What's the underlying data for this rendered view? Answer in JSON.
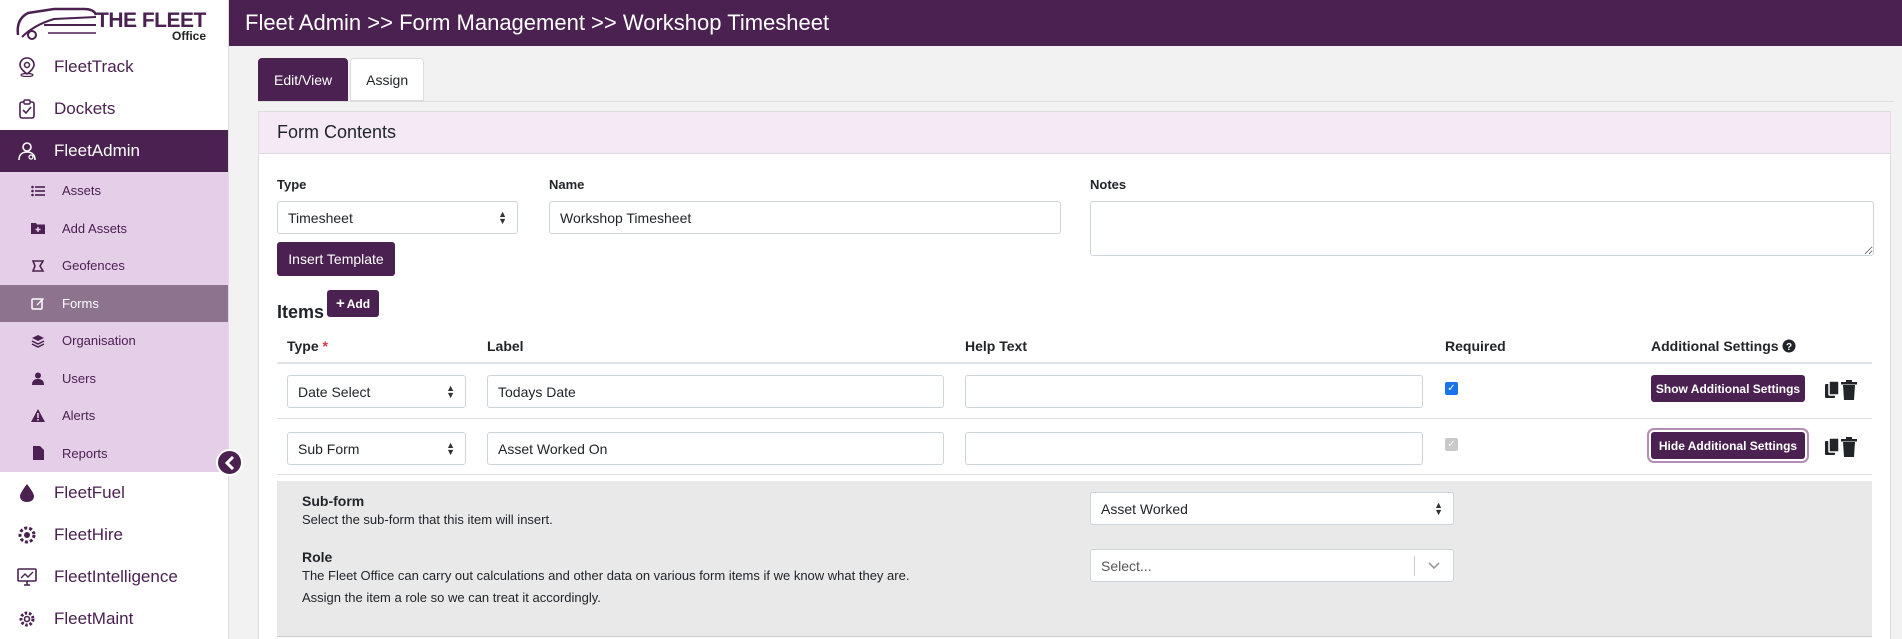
{
  "app": {
    "logo_text": "THE FLEET",
    "logo_sub": "Office",
    "breadcrumb": "Fleet Admin >> Form Management >> Workshop Timesheet"
  },
  "sidebar": {
    "main_top": [
      {
        "label": "FleetTrack",
        "icon": "map-pin-icon"
      },
      {
        "label": "Dockets",
        "icon": "clipboard-icon"
      },
      {
        "label": "FleetAdmin",
        "icon": "admin-user-icon",
        "active": true
      }
    ],
    "sub": [
      {
        "label": "Assets",
        "icon": "list-icon"
      },
      {
        "label": "Add Assets",
        "icon": "folder-plus-icon"
      },
      {
        "label": "Geofences",
        "icon": "geofence-icon"
      },
      {
        "label": "Forms",
        "icon": "edit-icon",
        "active": true
      },
      {
        "label": "Organisation",
        "icon": "layers-icon"
      },
      {
        "label": "Users",
        "icon": "user-icon"
      },
      {
        "label": "Alerts",
        "icon": "warning-icon"
      },
      {
        "label": "Reports",
        "icon": "report-icon"
      }
    ],
    "main_bottom": [
      {
        "label": "FleetFuel",
        "icon": "fuel-drop-icon"
      },
      {
        "label": "FleetHire",
        "icon": "hire-icon"
      },
      {
        "label": "FleetIntelligence",
        "icon": "monitor-icon"
      },
      {
        "label": "FleetMaint",
        "icon": "gear-icon"
      }
    ]
  },
  "tabs": [
    {
      "label": "Edit/View",
      "active": true
    },
    {
      "label": "Assign",
      "active": false
    }
  ],
  "form": {
    "header": "Form Contents",
    "type_label": "Type",
    "type_value": "Timesheet",
    "name_label": "Name",
    "name_value": "Workshop Timesheet",
    "notes_label": "Notes",
    "notes_value": "",
    "insert_template": "Insert Template"
  },
  "items": {
    "title": "Items",
    "add_label": "Add",
    "columns": {
      "type": "Type",
      "required_mark": "*",
      "label": "Label",
      "help": "Help Text",
      "required": "Required",
      "additional": "Additional Settings"
    },
    "rows": [
      {
        "type": "Date Select",
        "label": "Todays Date",
        "help": "",
        "required": true,
        "settings_btn": "Show Additional Settings"
      },
      {
        "type": "Sub Form",
        "label": "Asset Worked On",
        "help": "",
        "required": true,
        "settings_btn": "Hide Additional Settings"
      }
    ]
  },
  "subform": {
    "title": "Sub-form",
    "desc": "Select the sub-form that this item will insert.",
    "value": "Asset Worked",
    "role_title": "Role",
    "role_desc_1": "The Fleet Office can carry out calculations and other data on various form items if we know what they are.",
    "role_desc_2": "Assign the item a role so we can treat it accordingly.",
    "role_placeholder": "Select..."
  },
  "colors": {
    "brand": "#4a2150",
    "submenu_bg": "#e5cfe8",
    "submenu_active": "#8e738f",
    "card_header": "#f5e9f6"
  }
}
